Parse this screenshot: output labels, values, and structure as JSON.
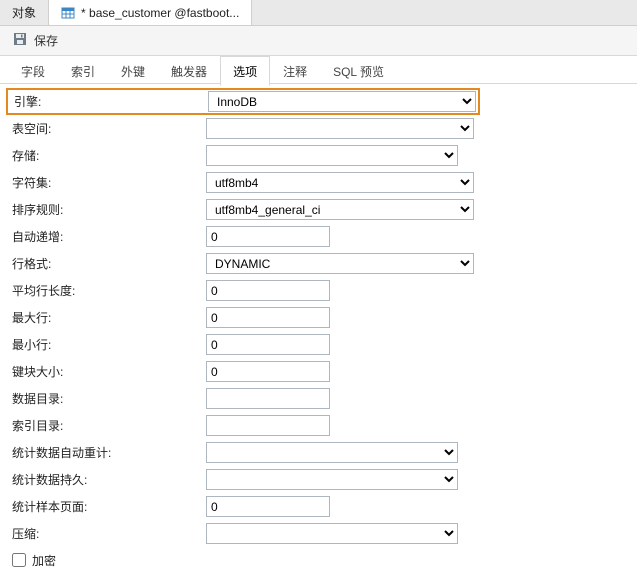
{
  "top_tabs": {
    "object": "对象",
    "table": "* base_customer @fastboot..."
  },
  "toolbar": {
    "save_label": "保存"
  },
  "subtabs": {
    "fields": "字段",
    "indexes": "索引",
    "fk": "外键",
    "triggers": "触发器",
    "options": "选项",
    "comment": "注释",
    "sqlprev": "SQL 预览"
  },
  "form": {
    "engine": {
      "label": "引擎:",
      "value": "InnoDB"
    },
    "tablespace": {
      "label": "表空间:",
      "value": ""
    },
    "storage": {
      "label": "存储:",
      "value": ""
    },
    "charset": {
      "label": "字符集:",
      "value": "utf8mb4"
    },
    "collation": {
      "label": "排序规则:",
      "value": "utf8mb4_general_ci"
    },
    "autoincr": {
      "label": "自动递增:",
      "value": "0"
    },
    "rowfmt": {
      "label": "行格式:",
      "value": "DYNAMIC"
    },
    "avglen": {
      "label": "平均行长度:",
      "value": "0"
    },
    "maxrow": {
      "label": "最大行:",
      "value": "0"
    },
    "minrow": {
      "label": "最小行:",
      "value": "0"
    },
    "keyblk": {
      "label": "键块大小:",
      "value": "0"
    },
    "datadir": {
      "label": "数据目录:",
      "value": ""
    },
    "indexdir": {
      "label": "索引目录:",
      "value": ""
    },
    "statsauto": {
      "label": "统计数据自动重计:",
      "value": ""
    },
    "statspersist": {
      "label": "统计数据持久:",
      "value": ""
    },
    "statspages": {
      "label": "统计样本页面:",
      "value": "0"
    },
    "compression": {
      "label": "压缩:",
      "value": ""
    },
    "encrypt": {
      "label": "加密"
    }
  }
}
